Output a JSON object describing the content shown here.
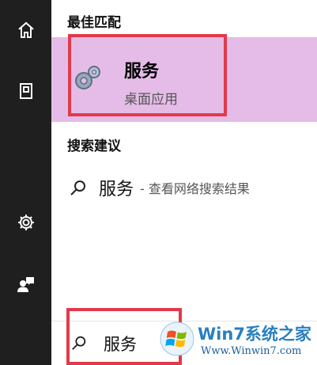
{
  "rail": {
    "items": [
      {
        "icon": "home-icon"
      },
      {
        "icon": "documents-icon"
      },
      {
        "icon": "gear-icon"
      },
      {
        "icon": "user-feedback-icon"
      }
    ]
  },
  "best_match": {
    "section_title": "最佳匹配",
    "app_name": "服务",
    "app_type": "桌面应用",
    "icon": "services-gears-icon"
  },
  "suggestions": {
    "section_title": "搜索建议",
    "items": [
      {
        "term": "服务",
        "desc": "- 查看网络搜索结果",
        "icon": "search-icon"
      }
    ]
  },
  "search": {
    "query": "服务",
    "icon": "search-icon"
  },
  "watermark": {
    "title": "Win7系统之家",
    "url": "Www.Winwin7.com"
  },
  "colors": {
    "rail_bg": "#1f1f1f",
    "highlight_bg": "#e5bce8",
    "annotation_red": "#e23a4a"
  }
}
